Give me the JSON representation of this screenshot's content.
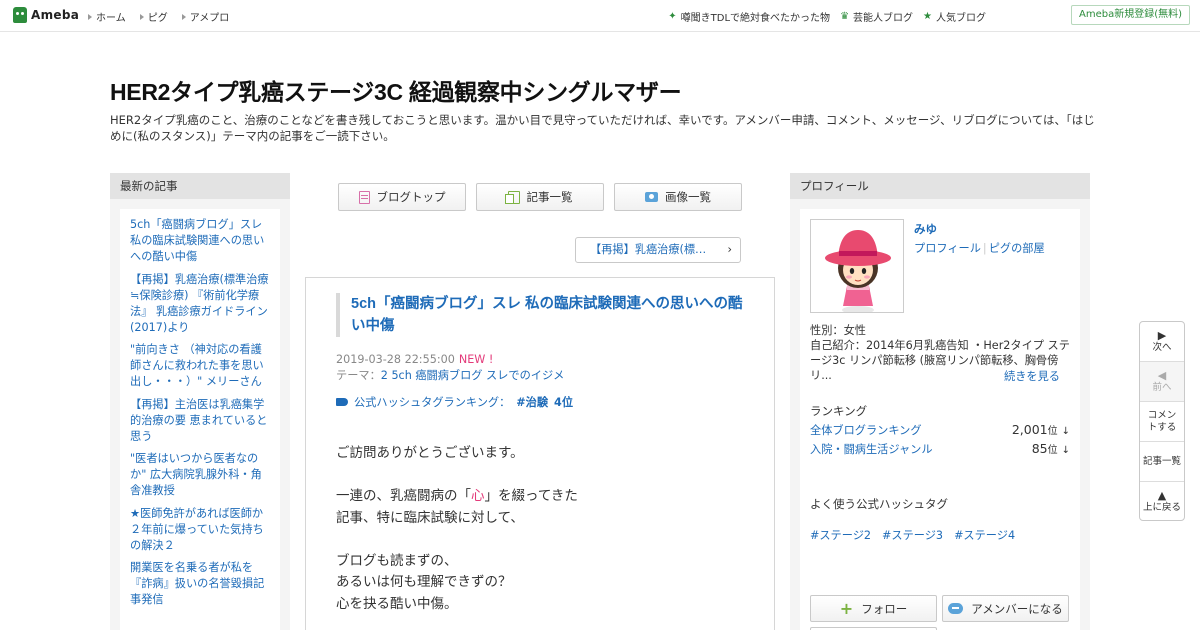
{
  "topbar": {
    "logo": "Ameba",
    "nav": [
      {
        "label": "ホーム"
      },
      {
        "label": "ピグ"
      },
      {
        "label": "アメプロ"
      }
    ],
    "right_links": [
      {
        "label": "噂聞きTDLで絶対食べたかった物",
        "icon": "sparkle-icon"
      },
      {
        "label": "芸能人ブログ",
        "icon": "crown-icon"
      },
      {
        "label": "人気ブログ",
        "icon": "star-icon"
      }
    ],
    "signup": "Ameba新規登録(無料)"
  },
  "blog": {
    "title": "HER2タイプ乳癌ステージ3C 経過観察中シングルマザー",
    "description": "HER2タイプ乳癌のこと、治療のことなどを書き残しておこうと思います。温かい目で見守っていただければ、幸いです。アメンバー申請、コメント、メッセージ、リブログについては、「はじめに(私のスタンス)」テーマ内の記事をご一読下さい。"
  },
  "left_sidebar": {
    "heading": "最新の記事",
    "items": [
      "5ch「癌闘病ブログ」スレ 私の臨床試験関連への思いへの酷い中傷",
      "【再掲】乳癌治療(標準治療≒保険診療) 『術前化学療法』 乳癌診療ガイドライン(2017)より",
      "\"前向きさ （神対応の看護師さんに救われた事を思い出し・・・）\" メリーさん",
      "【再掲】主治医は乳癌集学的治療の要 恵まれていると思う",
      "\"医者はいつから医者なのか\" 広大病院乳腺外科・角舎准教授",
      "★医師免許があれば医師か ２年前に爆っていた気持ちの解決２",
      "開業医を名乗る者が私を『詐病』扱いの名誉毀損記事発信"
    ]
  },
  "toolbar": {
    "blog_top": "ブログトップ",
    "entry_list": "記事一覧",
    "image_list": "画像一覧"
  },
  "prev_link": "【再掲】乳癌治療(標…",
  "article": {
    "title": "5ch「癌闘病ブログ」スレ 私の臨床試験関連への思いへの酷い中傷",
    "datetime": "2019-03-28 22:55:00",
    "new_badge": "NEW !",
    "theme_label": "テーマ：",
    "theme": "2 5ch 癌闘病ブログ スレでのイジメ",
    "hashtag_label": "公式ハッシュタグランキング：",
    "hashtag": "#治験",
    "hashtag_rank": "4位",
    "body": {
      "p1": "ご訪問ありがとうございます。",
      "p2a_pre": "一連の、乳癌闘病の「",
      "p2a_em": "心",
      "p2a_post": "」を綴ってきた",
      "p2b": "記事、特に臨床試験に対して、",
      "p3a": "ブログも読まずの、",
      "p3b": "あるいは何も理解できずの？",
      "p3c": "心を抉る酷い中傷。"
    }
  },
  "profile": {
    "heading": "プロフィール",
    "name": "みゆ",
    "link_profile": "プロフィール",
    "link_pig": "ピグの部屋",
    "gender": "性別：女性",
    "intro": "自己紹介：2014年6月乳癌告知 ・Her2タイプ ステージ3c リンパ節転移 (腋窩リンパ節転移、胸骨傍リ...",
    "more": "続きを見る",
    "ranking_heading": "ランキング",
    "rankings": [
      {
        "label": "全体ブログランキング",
        "value": "2,001",
        "unit": "位",
        "trend": "↓"
      },
      {
        "label": "入院・闘病生活ジャンル",
        "value": "85",
        "unit": "位",
        "trend": "↓"
      }
    ],
    "hashtag_heading": "よく使う公式ハッシュタグ",
    "hashtags": [
      "#ステージ2",
      "#ステージ3",
      "#ステージ4"
    ],
    "follow": "フォロー",
    "amember": "アメンバーになる"
  },
  "float_nav": {
    "next": "次へ",
    "prev": "前へ",
    "comment": "コメントする",
    "entries": "記事一覧",
    "top": "上に戻る"
  },
  "colors": {
    "link": "#1e6bb8",
    "brand_green": "#2d8c3c",
    "accent_pink": "#e33b7a"
  }
}
